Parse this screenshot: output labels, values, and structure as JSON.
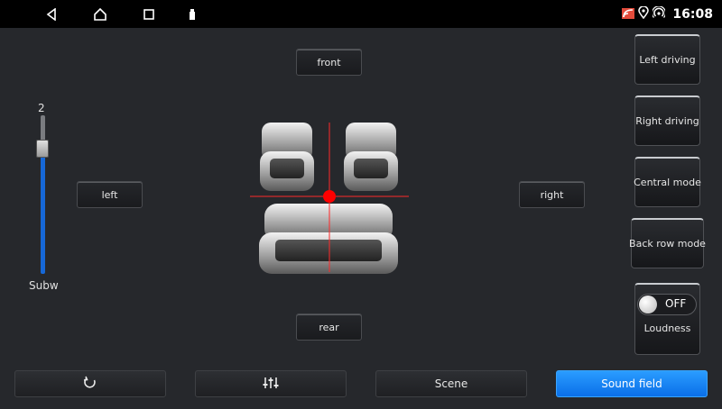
{
  "statusbar": {
    "time": "16:08",
    "nav_icons": [
      "back-icon",
      "home-icon",
      "recents-icon",
      "usb-icon"
    ],
    "status_icons": [
      "signal-icon",
      "location-icon",
      "hotspot-icon"
    ]
  },
  "sound_field": {
    "front_label": "front",
    "rear_label": "rear",
    "left_label": "left",
    "right_label": "right"
  },
  "subwoofer": {
    "value": "2",
    "label": "Subw"
  },
  "modes": {
    "left_driving": "Left driving",
    "right_driving": "Right driving",
    "central_mode": "Central mode",
    "back_row_mode": "Back row mode"
  },
  "loudness": {
    "label": "Loudness",
    "state": "OFF"
  },
  "tabs": {
    "reset_icon": "reset-icon",
    "eq_icon": "equalizer-icon",
    "scene": "Scene",
    "sound_field": "Sound field"
  },
  "colors": {
    "accent": "#0a6fe8",
    "slider": "#1668d8",
    "focus_point": "#ff0000",
    "background": "#26282c"
  }
}
